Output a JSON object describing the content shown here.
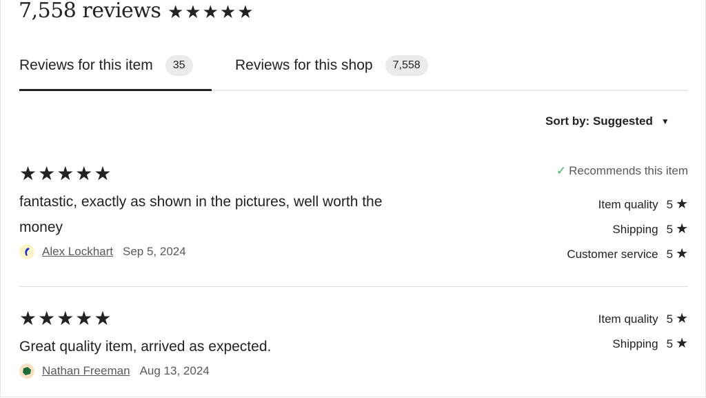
{
  "header": {
    "title": "7,558 reviews",
    "overall_rating": 5,
    "stars_icon": "★★★★★"
  },
  "tabs": [
    {
      "label": "Reviews for this item",
      "count": "35",
      "active": true
    },
    {
      "label": "Reviews for this shop",
      "count": "7,558",
      "active": false
    }
  ],
  "sort": {
    "label": "Sort by: Suggested",
    "caret": "▼"
  },
  "reviews": [
    {
      "stars_icon": "★★★★★",
      "rating": 5,
      "text": "fantastic, exactly as shown in the pictures, well worth the money",
      "author": "Alex Lockhart",
      "date": "Sep 5, 2024",
      "avatar_bg": "#fdf3c8",
      "avatar_fg": "#2233bb",
      "recommend": "Recommends this item",
      "check_icon": "✓",
      "ratings": [
        {
          "label": "Item quality",
          "value": "5",
          "star": "★"
        },
        {
          "label": "Shipping",
          "value": "5",
          "star": "★"
        },
        {
          "label": "Customer service",
          "value": "5",
          "star": "★"
        }
      ]
    },
    {
      "stars_icon": "★★★★★",
      "rating": 5,
      "text": "Great quality item, arrived as expected.",
      "author": "Nathan Freeman",
      "date": "Aug 13, 2024",
      "avatar_bg": "#fbe0c4",
      "avatar_fg": "#1e6b3a",
      "ratings": [
        {
          "label": "Item quality",
          "value": "5",
          "star": "★"
        },
        {
          "label": "Shipping",
          "value": "5",
          "star": "★"
        }
      ]
    }
  ]
}
